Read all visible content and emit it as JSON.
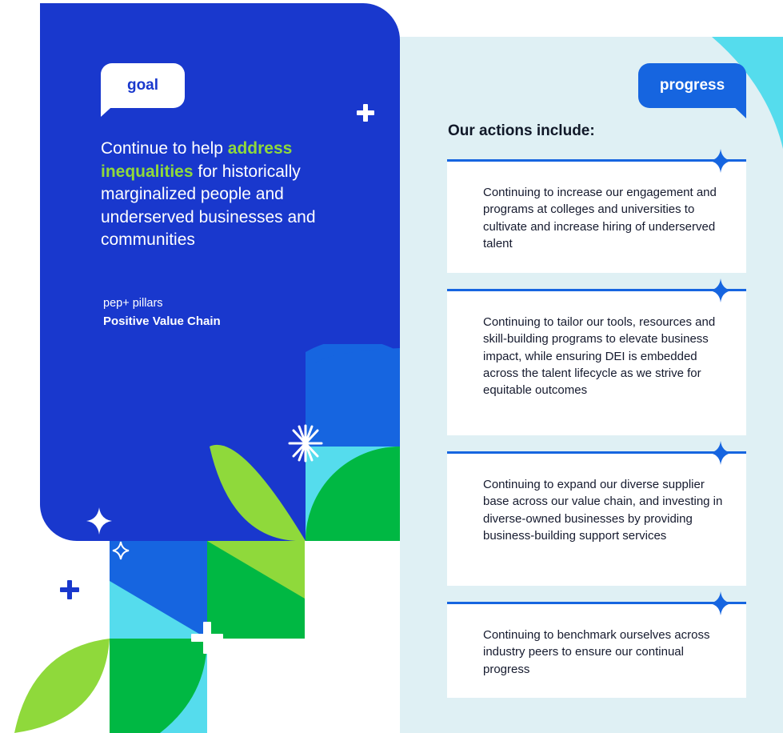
{
  "goal": {
    "badge": "goal",
    "text_before": "Continue to help ",
    "text_highlight": "address inequalities",
    "text_after": " for historically marginalized people and underserved businesses and communities",
    "pillars_label": "pep+ pillars",
    "pillars_value": "Positive Value Chain"
  },
  "progress": {
    "badge": "progress",
    "title": "Our actions include:",
    "actions": [
      "Continuing to increase our engagement and programs at colleges and universities to cultivate and increase hiring of underserved talent",
      "Continuing to tailor our tools, resources and skill-building programs to elevate business impact, while ensuring DEI is embedded across the talent lifecycle as we strive for equitable outcomes",
      "Continuing to expand our diverse supplier base across our value chain, and investing in diverse-owned businesses by providing business-building support services",
      "Continuing to benchmark ourselves across industry peers to ensure our continual progress"
    ]
  },
  "colors": {
    "card_blue": "#1938cd",
    "accent_blue": "#1665e0",
    "highlight_green": "#8fd93b",
    "panel_bg": "#dff0f4",
    "leaf_green": "#8fd93b",
    "dark_green": "#00b843",
    "cyan": "#55dced"
  },
  "icons": [
    "plus-icon",
    "sparkle-icon",
    "burst-icon"
  ]
}
